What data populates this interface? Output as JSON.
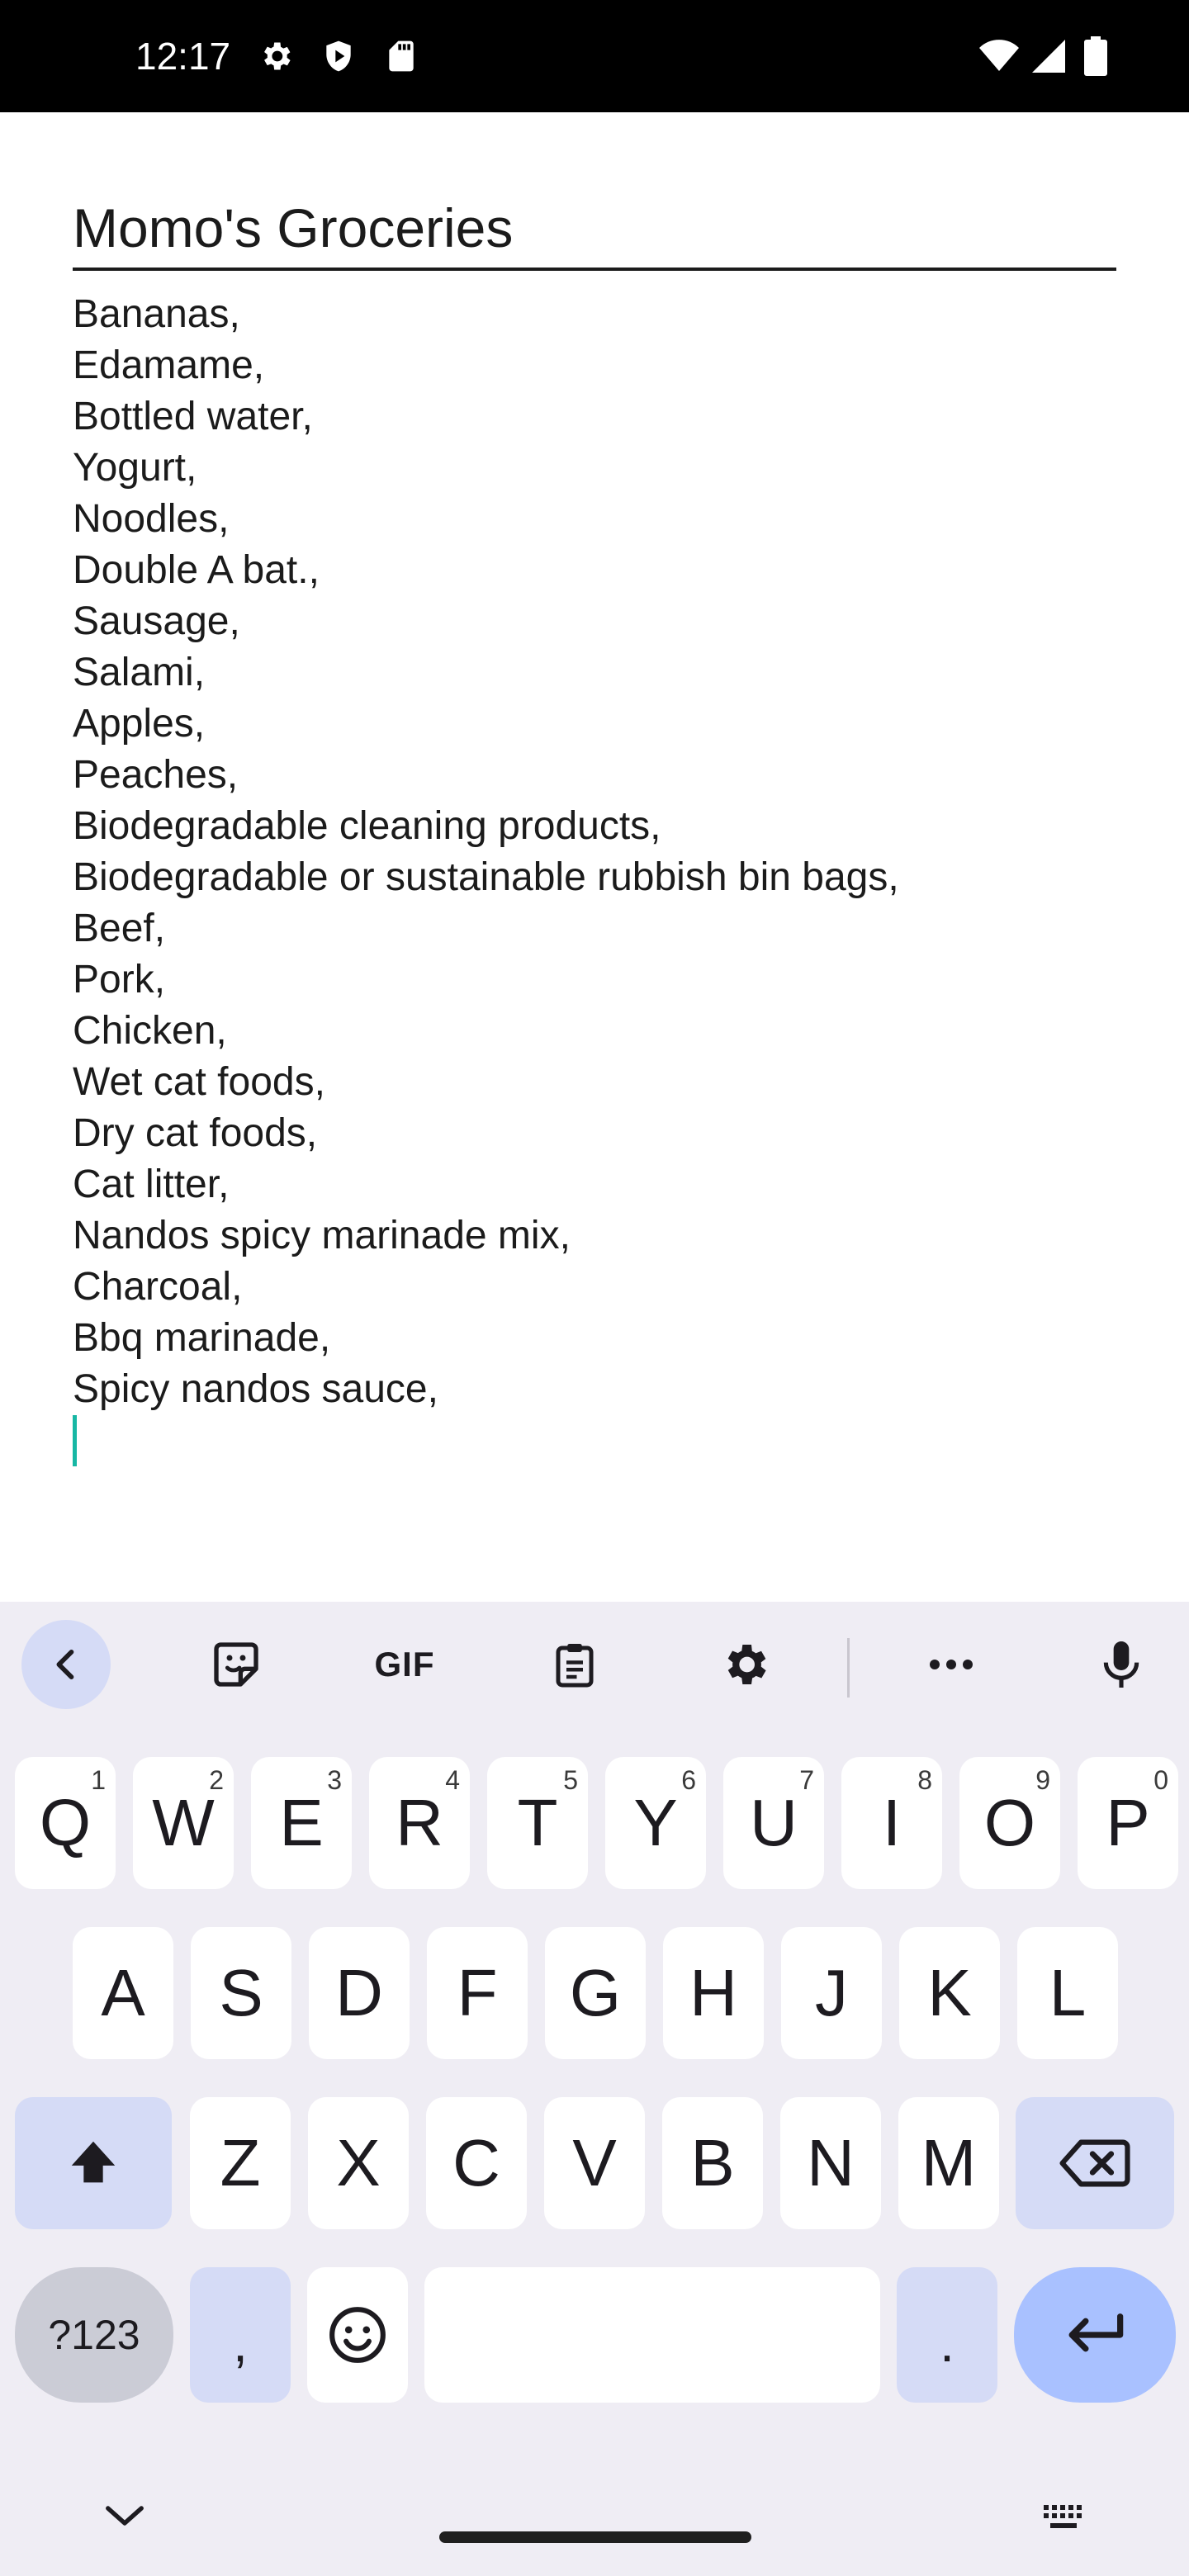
{
  "status_bar": {
    "time": "12:17",
    "left_icons": [
      "gear-icon",
      "shield-icon",
      "sd-card-icon"
    ],
    "right_icons": [
      "wifi-icon",
      "signal-icon",
      "battery-icon"
    ]
  },
  "note": {
    "title": "Momo's Groceries",
    "lines": [
      "Bananas,",
      "Edamame,",
      "Bottled water,",
      "Yogurt,",
      "Noodles,",
      "Double A bat.,",
      "Sausage,",
      "Salami,",
      "Apples,",
      "Peaches,",
      "Biodegradable cleaning products,",
      "Biodegradable or sustainable rubbish bin bags,",
      "Beef,",
      "Pork,",
      "Chicken,",
      "Wet cat foods,",
      "Dry cat foods,",
      "Cat litter,",
      "Nandos spicy marinade mix,",
      "Charcoal,",
      "Bbq marinade,",
      "Spicy nandos sauce,"
    ]
  },
  "keyboard": {
    "toolbar": {
      "gif_label": "GIF",
      "icons": [
        "chevron-left-icon",
        "sticker-icon",
        "gif-icon",
        "clipboard-icon",
        "settings-icon",
        "more-icon",
        "mic-icon"
      ]
    },
    "row1": [
      {
        "key": "Q",
        "hint": "1"
      },
      {
        "key": "W",
        "hint": "2"
      },
      {
        "key": "E",
        "hint": "3"
      },
      {
        "key": "R",
        "hint": "4"
      },
      {
        "key": "T",
        "hint": "5"
      },
      {
        "key": "Y",
        "hint": "6"
      },
      {
        "key": "U",
        "hint": "7"
      },
      {
        "key": "I",
        "hint": "8"
      },
      {
        "key": "O",
        "hint": "9"
      },
      {
        "key": "P",
        "hint": "0"
      }
    ],
    "row2": [
      "A",
      "S",
      "D",
      "F",
      "G",
      "H",
      "J",
      "K",
      "L"
    ],
    "row3": [
      "Z",
      "X",
      "C",
      "V",
      "B",
      "N",
      "M"
    ],
    "bottom": {
      "symbols_label": "?123",
      "comma_label": ",",
      "period_label": "."
    },
    "colors": {
      "background": "#efedf4",
      "key": "#ffffff",
      "modifier": "#d5dbf6",
      "enter": "#a9c1ff",
      "cursor": "#17b7a4"
    }
  }
}
